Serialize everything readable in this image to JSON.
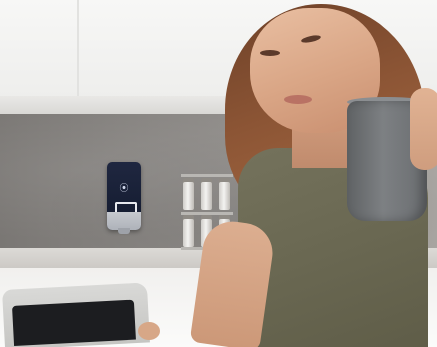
{
  "scene": {
    "alt_subject": "kitchen-photo",
    "palette": {
      "cabinet": "#f4f4f2",
      "backsplash": "#8a8784",
      "shirt": "#6a6852",
      "mug": "#707376",
      "hair": "#8c5535",
      "device": "#1a2136"
    },
    "icons": {
      "device_glyph": "wireless-icon"
    }
  }
}
